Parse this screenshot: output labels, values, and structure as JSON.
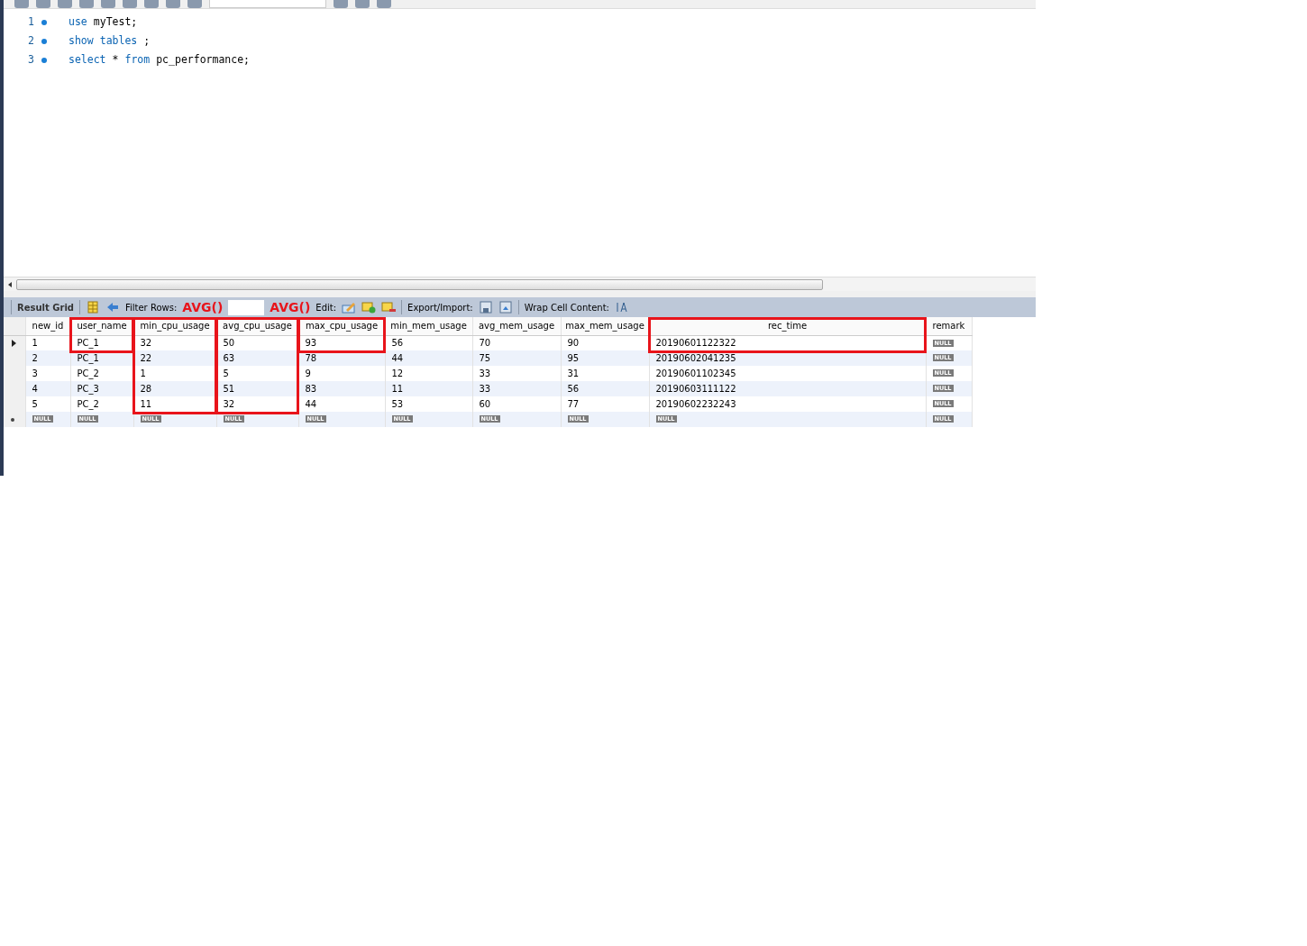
{
  "editor": {
    "lines": [
      {
        "number": "1",
        "tokens": [
          {
            "text": "use",
            "kind": "keyword"
          },
          {
            "text": "myTest;",
            "kind": "plain"
          }
        ]
      },
      {
        "number": "2",
        "tokens": [
          {
            "text": "show",
            "kind": "keyword"
          },
          {
            "text": "tables",
            "kind": "keyword"
          },
          {
            "text": ";",
            "kind": "plain"
          }
        ]
      },
      {
        "number": "3",
        "tokens": [
          {
            "text": "select",
            "kind": "keyword"
          },
          {
            "text": "*",
            "kind": "plain"
          },
          {
            "text": "from",
            "kind": "keyword"
          },
          {
            "text": "pc_performance;",
            "kind": "plain"
          }
        ]
      }
    ]
  },
  "result_toolbar": {
    "title": "Result Grid",
    "filter_label": "Filter Rows:",
    "edit_label": "Edit:",
    "export_label": "Export/Import:",
    "wrap_label": "Wrap Cell Content:"
  },
  "grid": {
    "columns": [
      {
        "name": "new_id",
        "highlight": false
      },
      {
        "name": "user_name",
        "highlight": true,
        "highlight_all_rows": false
      },
      {
        "name": "min_cpu_usage",
        "highlight": true,
        "highlight_all_rows": true,
        "note": "AVG()"
      },
      {
        "name": "avg_cpu_usage",
        "highlight": true,
        "highlight_all_rows": true,
        "note": "AVG()"
      },
      {
        "name": "max_cpu_usage",
        "highlight": true,
        "highlight_all_rows": false
      },
      {
        "name": "min_mem_usage",
        "highlight": false
      },
      {
        "name": "avg_mem_usage",
        "highlight": false
      },
      {
        "name": "max_mem_usage",
        "highlight": false
      },
      {
        "name": "rec_time",
        "highlight": true,
        "highlight_all_rows": false
      },
      {
        "name": "remark",
        "highlight": false
      }
    ],
    "rows": [
      {
        "current": true,
        "kind": "data",
        "cells": [
          "1",
          "PC_1",
          "32",
          "50",
          "93",
          "56",
          "70",
          "90",
          "20190601122322",
          "NULL"
        ]
      },
      {
        "current": false,
        "kind": "data",
        "cells": [
          "2",
          "PC_1",
          "22",
          "63",
          "78",
          "44",
          "75",
          "95",
          "20190602041235",
          "NULL"
        ]
      },
      {
        "current": false,
        "kind": "data",
        "cells": [
          "3",
          "PC_2",
          "1",
          "5",
          "9",
          "12",
          "33",
          "31",
          "20190601102345",
          "NULL"
        ]
      },
      {
        "current": false,
        "kind": "data",
        "cells": [
          "4",
          "PC_3",
          "28",
          "51",
          "83",
          "11",
          "33",
          "56",
          "20190603111122",
          "NULL"
        ]
      },
      {
        "current": false,
        "kind": "data",
        "cells": [
          "5",
          "PC_2",
          "11",
          "32",
          "44",
          "53",
          "60",
          "77",
          "20190602232243",
          "NULL"
        ]
      },
      {
        "current": false,
        "kind": "new",
        "cells": [
          "NULL",
          "NULL",
          "NULL",
          "NULL",
          "NULL",
          "NULL",
          "NULL",
          "NULL",
          "NULL",
          "NULL"
        ]
      }
    ]
  }
}
